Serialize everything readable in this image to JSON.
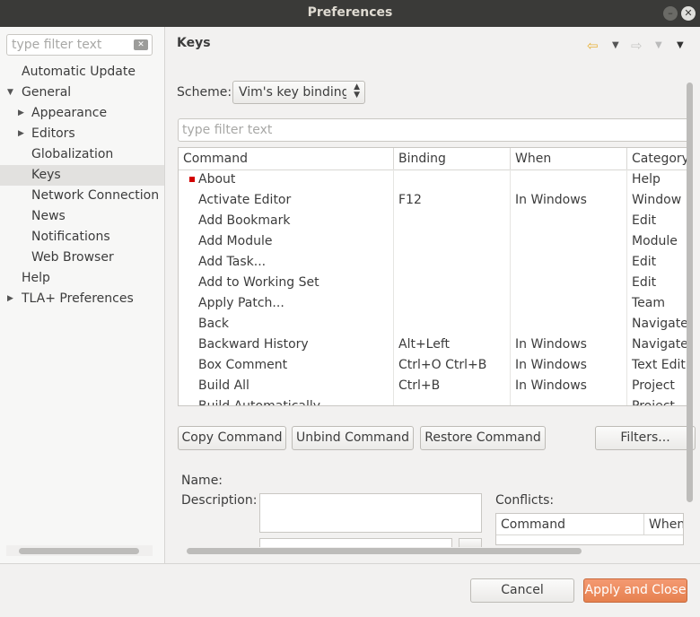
{
  "window": {
    "title": "Preferences"
  },
  "sidebar": {
    "filter_placeholder": "type filter text",
    "items": [
      {
        "label": "Automatic Update"
      },
      {
        "label": "General"
      },
      {
        "label": "Appearance"
      },
      {
        "label": "Editors"
      },
      {
        "label": "Globalization"
      },
      {
        "label": "Keys"
      },
      {
        "label": "Network Connection"
      },
      {
        "label": "News"
      },
      {
        "label": "Notifications"
      },
      {
        "label": "Web Browser"
      },
      {
        "label": "Help"
      },
      {
        "label": "TLA+ Preferences"
      }
    ],
    "selected": "Keys"
  },
  "page": {
    "title": "Keys",
    "scheme_label": "Scheme:",
    "scheme_value": "Vim's key bindings",
    "filter_placeholder": "type filter text"
  },
  "table": {
    "columns": [
      "Command",
      "Binding",
      "When",
      "Category"
    ],
    "rows": [
      {
        "command": "About",
        "binding": "",
        "when": "",
        "category": "Help"
      },
      {
        "command": "Activate Editor",
        "binding": "F12",
        "when": "In Windows",
        "category": "Window"
      },
      {
        "command": "Add Bookmark",
        "binding": "",
        "when": "",
        "category": "Edit"
      },
      {
        "command": "Add Module",
        "binding": "",
        "when": "",
        "category": "Module"
      },
      {
        "command": "Add Task...",
        "binding": "",
        "when": "",
        "category": "Edit"
      },
      {
        "command": "Add to Working Set",
        "binding": "",
        "when": "",
        "category": "Edit"
      },
      {
        "command": "Apply Patch...",
        "binding": "",
        "when": "",
        "category": "Team"
      },
      {
        "command": "Back",
        "binding": "",
        "when": "",
        "category": "Navigate"
      },
      {
        "command": "Backward History",
        "binding": "Alt+Left",
        "when": "In Windows",
        "category": "Navigate"
      },
      {
        "command": "Box Comment",
        "binding": "Ctrl+O Ctrl+B",
        "when": "In Windows",
        "category": "Text Edit"
      },
      {
        "command": "Build All",
        "binding": "Ctrl+B",
        "when": "In Windows",
        "category": "Project"
      },
      {
        "command": "Build Automatically",
        "binding": "",
        "when": "",
        "category": "Project"
      }
    ]
  },
  "buttons": {
    "copy": "Copy Command",
    "unbind": "Unbind Command",
    "restore": "Restore Command",
    "filters": "Filters...",
    "cancel": "Cancel",
    "apply_close": "Apply and Close"
  },
  "details": {
    "name_label": "Name:",
    "description_label": "Description:",
    "conflicts_label": "Conflicts:",
    "conflicts_columns": [
      "Command",
      "When"
    ]
  },
  "icons": {
    "back": "arrow-left-icon",
    "forward": "arrow-right-icon",
    "menu": "view-menu-icon"
  },
  "colors": {
    "accent": "#e6814f",
    "marker": "#d20000",
    "back_arrow": "#e8b23a"
  }
}
